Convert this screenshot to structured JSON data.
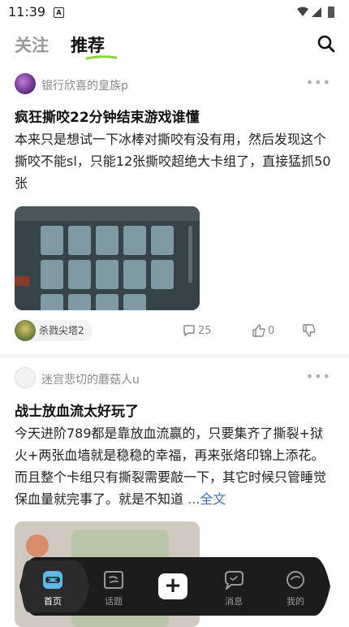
{
  "status_bar": {
    "time": "11:39"
  },
  "header": {
    "tabs": [
      {
        "label": "关注"
      },
      {
        "label": "推荐"
      }
    ],
    "accent": "#8bd63a"
  },
  "posts": [
    {
      "author": "银行欣喜的皇族p",
      "title": "疯狂撕咬22分钟结束游戏谁懂",
      "body": "本来只是想试一下冰棒对撕咬有没有用，然后发现这个撕咬不能sl，只能12张撕咬超绝大卡组了，直接猛抓50张",
      "tag": "杀戮尖塔2",
      "comments": "25",
      "likes": "0"
    },
    {
      "author": "迷宫悲切的蘑菇人u",
      "title": "战士放血流太好玩了",
      "body": "今天进阶789都是靠放血流赢的，只要集齐了撕裂+狱火+两张血墙就是稳稳的幸福，再来张烙印锦上添花。而且整个卡组只有撕裂需要敲一下，其它时候只管睡觉保血量就完事了。就是不知道",
      "more_label": "...全文"
    }
  ],
  "bottom_nav": {
    "items": [
      {
        "label": "首页"
      },
      {
        "label": "话题"
      },
      {
        "label": "消息"
      },
      {
        "label": "我的"
      }
    ],
    "plus": "+"
  }
}
